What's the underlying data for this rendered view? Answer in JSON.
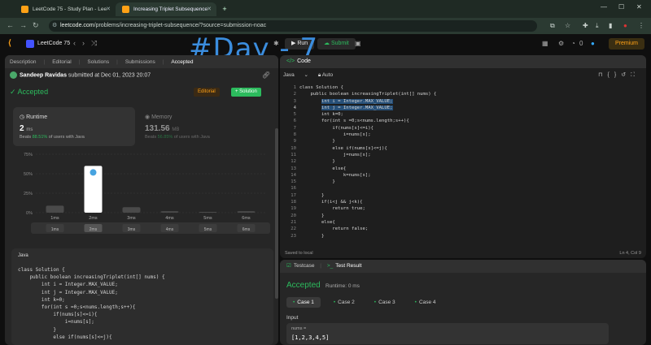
{
  "browser": {
    "tabs": [
      {
        "title": "LeetCode 75 - Study Plan - Lee"
      },
      {
        "title": "Increasing Triplet Subsequence"
      }
    ],
    "url_host": "leetcode.com",
    "url_path": "/problems/increasing-triplet-subsequence/?source=submission-noac"
  },
  "lcnav": {
    "title": "LeetCode 75",
    "run_label": "Run",
    "submit_label": "Submit",
    "coins": "0",
    "premium_label": "Premium"
  },
  "overlay_text": "#Day - 7",
  "left": {
    "tabs": [
      "Description",
      "Editorial",
      "Solutions",
      "Submissions",
      "Accepted"
    ],
    "submitter": "Sandeep Ravidas",
    "submitted_text": "submitted at Dec 01, 2023 20:07",
    "status": "Accepted",
    "editorial_label": "Editorial",
    "solution_label": "Solution",
    "runtime": {
      "label": "Runtime",
      "value": "2",
      "unit": "ms",
      "beats_prefix": "Beats",
      "beats_pct": "88.51%",
      "beats_suffix": "of users with Java"
    },
    "memory": {
      "label": "Memory",
      "value": "131.56",
      "unit": "MB",
      "beats_prefix": "Beats",
      "beats_pct": "56.85%",
      "beats_suffix": "of users with Java"
    },
    "code_lang": "Java",
    "code_preview": "class Solution {\n    public boolean increasingTriplet(int[] nums) {\n        int i = Integer.MAX_VALUE;\n        int j = Integer.MAX_VALUE;\n        int k=0;\n        for(int s =0;s<nums.length;s++){\n            if(nums[s]<=i){\n                i=nums[s];\n            }\n            else if(nums[s]<=j){"
  },
  "chart_data": {
    "type": "bar",
    "categories": [
      "1ms",
      "2ms",
      "3ms",
      "4ms",
      "5ms",
      "6ms"
    ],
    "values": [
      9,
      60,
      7,
      2,
      1,
      2
    ],
    "highlight_index": 1,
    "ylabel": "",
    "yticks": [
      "75%",
      "50%",
      "25%",
      "0%"
    ],
    "ylim": [
      0,
      75
    ],
    "range_labels": [
      "1ms",
      "2ms",
      "3ms",
      "4ms",
      "5ms",
      "6ms"
    ]
  },
  "right": {
    "header": "Code",
    "language": "Java",
    "auto_label": "Auto",
    "code_lines": [
      "class Solution {",
      "    public boolean increasingTriplet(int[] nums) {",
      "        int i = Integer.MAX_VALUE;",
      "        int j = Integer.MAX_VALUE;",
      "        int k=0;",
      "        for(int s =0;s<nums.length;s++){",
      "            if(nums[s]<=i){",
      "                i=nums[s];",
      "            }",
      "            else if(nums[s]<=j){",
      "                j=nums[s];",
      "            }",
      "            else{",
      "                k=nums[s];",
      "            }",
      "",
      "        }",
      "        if(i<j && j<k){",
      "            return true;",
      "        }",
      "        else{",
      "            return false;",
      "        }"
    ],
    "saved_text": "Saved to local",
    "cursor_pos": "Ln 4, Col 9"
  },
  "bottom": {
    "testcase_label": "Testcase",
    "testresult_label": "Test Result",
    "status": "Accepted",
    "runtime_text": "Runtime: 0 ms",
    "cases": [
      "Case 1",
      "Case 2",
      "Case 3",
      "Case 4"
    ],
    "input_label": "Input",
    "input_key": "nums =",
    "input_value": "[1,2,3,4,5]"
  }
}
